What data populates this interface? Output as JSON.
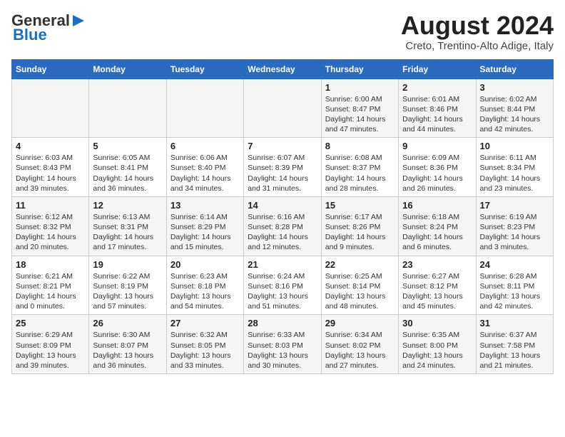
{
  "header": {
    "logo_general": "General",
    "logo_blue": "Blue",
    "month": "August 2024",
    "location": "Creto, Trentino-Alto Adige, Italy"
  },
  "days_of_week": [
    "Sunday",
    "Monday",
    "Tuesday",
    "Wednesday",
    "Thursday",
    "Friday",
    "Saturday"
  ],
  "weeks": [
    [
      {
        "day": "",
        "info": ""
      },
      {
        "day": "",
        "info": ""
      },
      {
        "day": "",
        "info": ""
      },
      {
        "day": "",
        "info": ""
      },
      {
        "day": "1",
        "info": "Sunrise: 6:00 AM\nSunset: 8:47 PM\nDaylight: 14 hours and 47 minutes."
      },
      {
        "day": "2",
        "info": "Sunrise: 6:01 AM\nSunset: 8:46 PM\nDaylight: 14 hours and 44 minutes."
      },
      {
        "day": "3",
        "info": "Sunrise: 6:02 AM\nSunset: 8:44 PM\nDaylight: 14 hours and 42 minutes."
      }
    ],
    [
      {
        "day": "4",
        "info": "Sunrise: 6:03 AM\nSunset: 8:43 PM\nDaylight: 14 hours and 39 minutes."
      },
      {
        "day": "5",
        "info": "Sunrise: 6:05 AM\nSunset: 8:41 PM\nDaylight: 14 hours and 36 minutes."
      },
      {
        "day": "6",
        "info": "Sunrise: 6:06 AM\nSunset: 8:40 PM\nDaylight: 14 hours and 34 minutes."
      },
      {
        "day": "7",
        "info": "Sunrise: 6:07 AM\nSunset: 8:39 PM\nDaylight: 14 hours and 31 minutes."
      },
      {
        "day": "8",
        "info": "Sunrise: 6:08 AM\nSunset: 8:37 PM\nDaylight: 14 hours and 28 minutes."
      },
      {
        "day": "9",
        "info": "Sunrise: 6:09 AM\nSunset: 8:36 PM\nDaylight: 14 hours and 26 minutes."
      },
      {
        "day": "10",
        "info": "Sunrise: 6:11 AM\nSunset: 8:34 PM\nDaylight: 14 hours and 23 minutes."
      }
    ],
    [
      {
        "day": "11",
        "info": "Sunrise: 6:12 AM\nSunset: 8:32 PM\nDaylight: 14 hours and 20 minutes."
      },
      {
        "day": "12",
        "info": "Sunrise: 6:13 AM\nSunset: 8:31 PM\nDaylight: 14 hours and 17 minutes."
      },
      {
        "day": "13",
        "info": "Sunrise: 6:14 AM\nSunset: 8:29 PM\nDaylight: 14 hours and 15 minutes."
      },
      {
        "day": "14",
        "info": "Sunrise: 6:16 AM\nSunset: 8:28 PM\nDaylight: 14 hours and 12 minutes."
      },
      {
        "day": "15",
        "info": "Sunrise: 6:17 AM\nSunset: 8:26 PM\nDaylight: 14 hours and 9 minutes."
      },
      {
        "day": "16",
        "info": "Sunrise: 6:18 AM\nSunset: 8:24 PM\nDaylight: 14 hours and 6 minutes."
      },
      {
        "day": "17",
        "info": "Sunrise: 6:19 AM\nSunset: 8:23 PM\nDaylight: 14 hours and 3 minutes."
      }
    ],
    [
      {
        "day": "18",
        "info": "Sunrise: 6:21 AM\nSunset: 8:21 PM\nDaylight: 14 hours and 0 minutes."
      },
      {
        "day": "19",
        "info": "Sunrise: 6:22 AM\nSunset: 8:19 PM\nDaylight: 13 hours and 57 minutes."
      },
      {
        "day": "20",
        "info": "Sunrise: 6:23 AM\nSunset: 8:18 PM\nDaylight: 13 hours and 54 minutes."
      },
      {
        "day": "21",
        "info": "Sunrise: 6:24 AM\nSunset: 8:16 PM\nDaylight: 13 hours and 51 minutes."
      },
      {
        "day": "22",
        "info": "Sunrise: 6:25 AM\nSunset: 8:14 PM\nDaylight: 13 hours and 48 minutes."
      },
      {
        "day": "23",
        "info": "Sunrise: 6:27 AM\nSunset: 8:12 PM\nDaylight: 13 hours and 45 minutes."
      },
      {
        "day": "24",
        "info": "Sunrise: 6:28 AM\nSunset: 8:11 PM\nDaylight: 13 hours and 42 minutes."
      }
    ],
    [
      {
        "day": "25",
        "info": "Sunrise: 6:29 AM\nSunset: 8:09 PM\nDaylight: 13 hours and 39 minutes."
      },
      {
        "day": "26",
        "info": "Sunrise: 6:30 AM\nSunset: 8:07 PM\nDaylight: 13 hours and 36 minutes."
      },
      {
        "day": "27",
        "info": "Sunrise: 6:32 AM\nSunset: 8:05 PM\nDaylight: 13 hours and 33 minutes."
      },
      {
        "day": "28",
        "info": "Sunrise: 6:33 AM\nSunset: 8:03 PM\nDaylight: 13 hours and 30 minutes."
      },
      {
        "day": "29",
        "info": "Sunrise: 6:34 AM\nSunset: 8:02 PM\nDaylight: 13 hours and 27 minutes."
      },
      {
        "day": "30",
        "info": "Sunrise: 6:35 AM\nSunset: 8:00 PM\nDaylight: 13 hours and 24 minutes."
      },
      {
        "day": "31",
        "info": "Sunrise: 6:37 AM\nSunset: 7:58 PM\nDaylight: 13 hours and 21 minutes."
      }
    ]
  ]
}
